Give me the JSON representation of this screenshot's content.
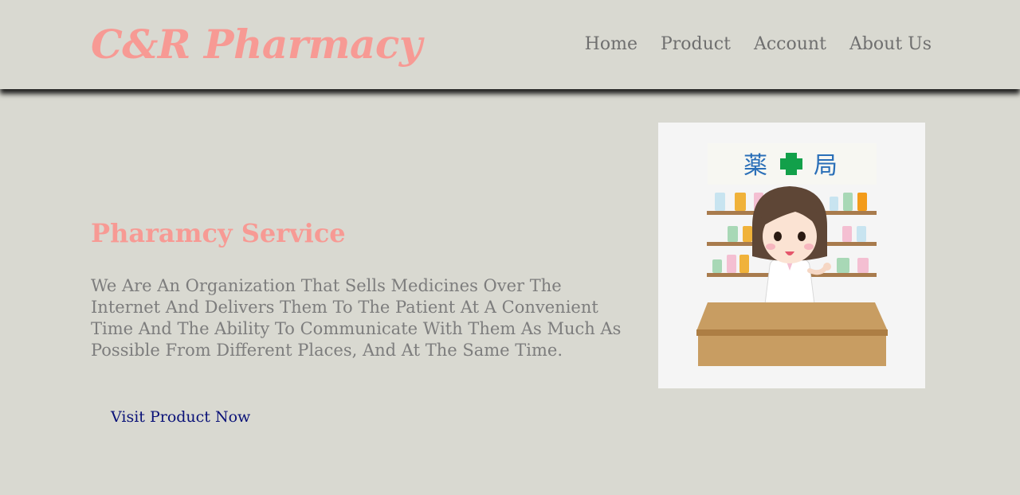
{
  "header": {
    "logo": "C&R Pharmacy",
    "nav": [
      "Home",
      "Product",
      "Account",
      "About Us"
    ]
  },
  "hero": {
    "title": "Pharamcy Service",
    "description": "We Are An Organization That Sells Medicines Over The Internet And Delivers Them To The Patient At A Convenient Time And The Ability To Communicate With Them As Much As Possible From Different Places, And At The Same Time.",
    "cta_label": "Visit Product Now",
    "illustration": {
      "sign_left": "薬",
      "sign_right": "局",
      "icon": "pharmacist-illustration"
    }
  },
  "colors": {
    "background": "#d9d9d1",
    "brand_pink": "#f79a94",
    "nav_text": "#6f6f6f",
    "body_text": "#7d7d7d",
    "link_blue": "#0a1278"
  }
}
